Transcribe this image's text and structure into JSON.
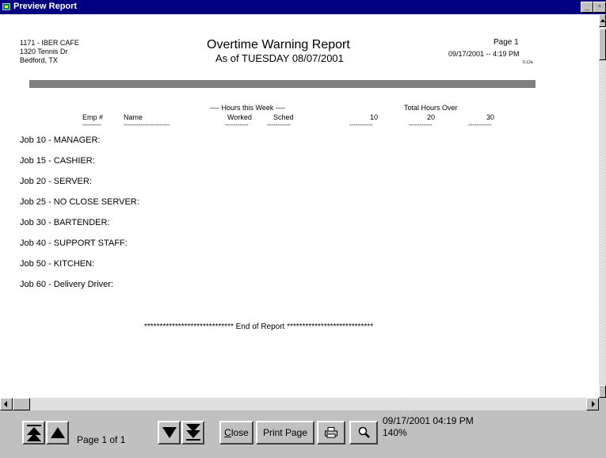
{
  "window": {
    "title": "Preview Report",
    "minimize_glyph": "_",
    "maximize_glyph": "▫",
    "close_glyph": "x"
  },
  "report": {
    "store_line1": "1171 - IBER CAFE",
    "store_line2": "1320 Tennis Dr",
    "store_line3": "Bedford, TX",
    "title": "Overtime Warning Report",
    "subtitle": "As of TUESDAY 08/07/2001",
    "page": "Page 1",
    "printed": "09/17/2001 --  4:19 PM",
    "version": "5.12a",
    "group_header_hours": "---- Hours this Week ----",
    "group_header_total": "Total Hours Over",
    "columns": {
      "emp": "Emp #",
      "name": "Name",
      "worked": "Worked",
      "sched": "Sched",
      "c10": "10",
      "c20": "20",
      "c30": "30"
    },
    "underlines": {
      "emp": "---------",
      "name": "----------------------",
      "worked": "-----------",
      "sched": "-----------",
      "c10": "-----------",
      "c20": "-----------",
      "c30": "-----------"
    },
    "jobs": [
      "Job 10 - MANAGER:",
      "Job 15 - CASHIER:",
      "Job 20 - SERVER:",
      "Job 25 - NO CLOSE SERVER:",
      "Job 30 - BARTENDER:",
      "Job 40 - SUPPORT STAFF:",
      "Job 50 - KITCHEN:",
      "Job 60 - Delivery Driver:"
    ],
    "end_of_report": "***************************** End of Report ****************************"
  },
  "toolbar": {
    "page_label": "Page 1 of 1",
    "close_label": "Close",
    "close_hotkey": "C",
    "close_rest": "lose",
    "print_page_label": "Print Page",
    "status_datetime": "09/17/2001 04:19 PM",
    "zoom": "140%",
    "printer_icon": "printer-icon",
    "zoom_icon": "magnifier-icon"
  },
  "colors": {
    "titlebar": "#000080",
    "face": "#c0c0c0",
    "paper": "#ffffff",
    "bar": "#808080"
  }
}
